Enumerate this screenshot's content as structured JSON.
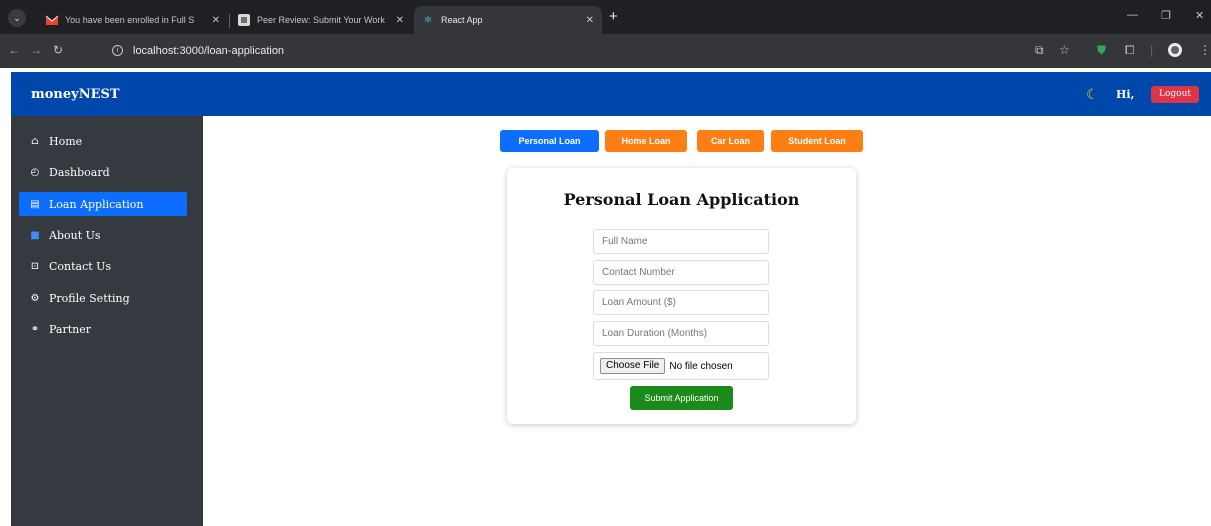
{
  "browser": {
    "tabs": [
      {
        "title": "You have been enrolled in Full S",
        "close": "✕"
      },
      {
        "title": "Peer Review: Submit Your Work",
        "close": "✕"
      },
      {
        "title": "React App",
        "close": "✕"
      }
    ],
    "new_tab": "+",
    "url": "localhost:3000/loan-application"
  },
  "header": {
    "brand": "moneyNEST",
    "greeting": "Hi,",
    "logout_label": "Logout"
  },
  "sidebar": {
    "items": [
      {
        "label": "Home",
        "icon": "home-icon"
      },
      {
        "label": "Dashboard",
        "icon": "dashboard-icon"
      },
      {
        "label": "Loan Application",
        "icon": "application-icon",
        "active": true
      },
      {
        "label": "About Us",
        "icon": "info-icon"
      },
      {
        "label": "Contact Us",
        "icon": "contact-icon"
      },
      {
        "label": "Profile Setting",
        "icon": "gear-icon"
      },
      {
        "label": "Partner",
        "icon": "handshake-icon"
      }
    ]
  },
  "loan_types": {
    "personal": "Personal Loan",
    "home": "Home Loan",
    "car": "Car Loan",
    "student": "Student Loan",
    "selected": "Personal Loan"
  },
  "form": {
    "title": "Personal Loan Application",
    "full_name_placeholder": "Full Name",
    "contact_placeholder": "Contact Number",
    "amount_placeholder": "Loan Amount ($)",
    "duration_placeholder": "Loan Duration (Months)",
    "choose_file_label": "Choose File",
    "no_file_text": "No file chosen",
    "submit_label": "Submit Application"
  },
  "colors": {
    "header_bg": "#0047ab",
    "sidebar_bg": "#343a40",
    "active_blue": "#0d6efd",
    "loan_orange": "#fd7e14",
    "submit_green": "#1a8a1a",
    "logout_red": "#dc3545"
  }
}
